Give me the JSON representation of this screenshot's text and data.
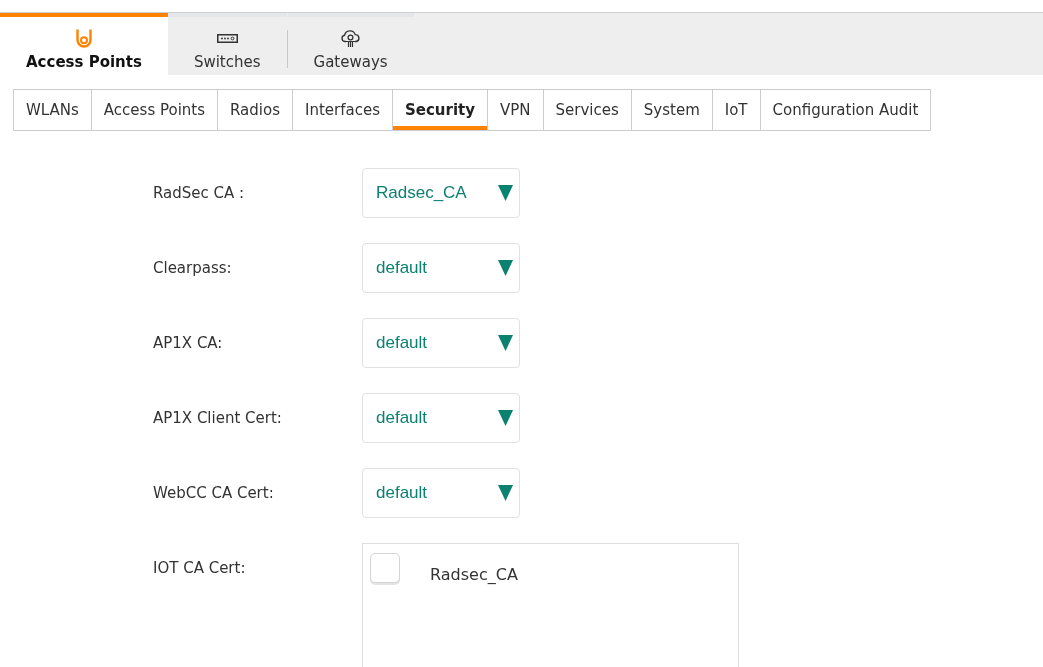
{
  "product_tabs": [
    {
      "label": "Access Points",
      "kind": "access-point",
      "selected": true
    },
    {
      "label": "Switches",
      "kind": "switch",
      "selected": false
    },
    {
      "label": "Gateways",
      "kind": "gateway",
      "selected": false
    }
  ],
  "config_tabs": [
    {
      "label": "WLANs",
      "selected": false
    },
    {
      "label": "Access Points",
      "selected": false
    },
    {
      "label": "Radios",
      "selected": false
    },
    {
      "label": "Interfaces",
      "selected": false
    },
    {
      "label": "Security",
      "selected": true
    },
    {
      "label": "VPN",
      "selected": false
    },
    {
      "label": "Services",
      "selected": false
    },
    {
      "label": "System",
      "selected": false
    },
    {
      "label": "IoT",
      "selected": false
    },
    {
      "label": "Configuration Audit",
      "selected": false
    }
  ],
  "fields": [
    {
      "label": "RadSec CA :",
      "kind": "select",
      "value": "Radsec_CA"
    },
    {
      "label": "Clearpass:",
      "kind": "select",
      "value": "default"
    },
    {
      "label": "AP1X CA:",
      "kind": "select",
      "value": "default"
    },
    {
      "label": "AP1X Client Cert:",
      "kind": "select",
      "value": "default"
    },
    {
      "label": "WebCC CA Cert:",
      "kind": "select",
      "value": "default"
    },
    {
      "label": "IOT CA Cert:",
      "kind": "checklist",
      "options": [
        {
          "label": "Radsec_CA",
          "checked": false
        }
      ]
    }
  ]
}
